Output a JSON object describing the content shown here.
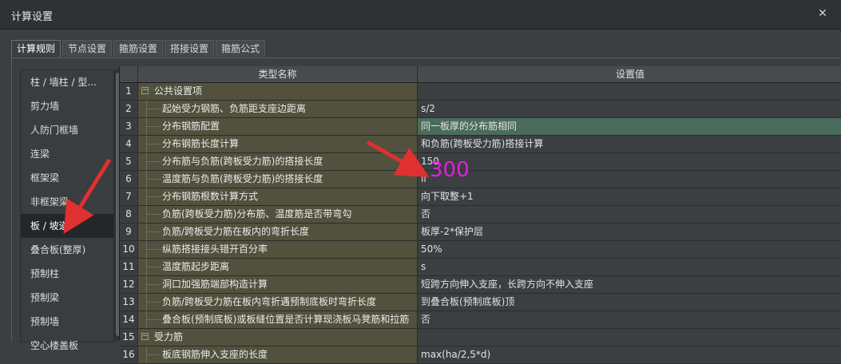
{
  "window": {
    "title": "计算设置"
  },
  "tabs": [
    {
      "label": "计算规则"
    },
    {
      "label": "节点设置"
    },
    {
      "label": "箍筋设置"
    },
    {
      "label": "搭接设置"
    },
    {
      "label": "箍筋公式"
    }
  ],
  "sidebar": {
    "items": [
      {
        "label": "柱 / 墙柱 / 型..."
      },
      {
        "label": "剪力墙"
      },
      {
        "label": "人防门框墙"
      },
      {
        "label": "连梁"
      },
      {
        "label": "框架梁"
      },
      {
        "label": "非框架梁"
      },
      {
        "label": "板 / 坡道"
      },
      {
        "label": "叠合板(整厚)"
      },
      {
        "label": "预制柱"
      },
      {
        "label": "预制梁"
      },
      {
        "label": "预制墙"
      },
      {
        "label": "空心楼盖板"
      }
    ],
    "selected": "板 / 坡道"
  },
  "grid": {
    "columns": [
      {
        "label": "类型名称"
      },
      {
        "label": "设置值"
      }
    ],
    "rows": [
      {
        "num": "1",
        "name": "公共设置项",
        "value": ""
      },
      {
        "num": "2",
        "name": "起始受力钢筋、负筋距支座边距离",
        "value": "s/2"
      },
      {
        "num": "3",
        "name": "分布钢筋配置",
        "value": "同一板厚的分布筋相同"
      },
      {
        "num": "4",
        "name": "分布钢筋长度计算",
        "value": "和负筋(跨板受力筋)搭接计算"
      },
      {
        "num": "5",
        "name": "分布筋与负筋(跨板受力筋)的搭接长度",
        "value": "150"
      },
      {
        "num": "6",
        "name": "温度筋与负筋(跨板受力筋)的搭接长度",
        "value": "ll"
      },
      {
        "num": "7",
        "name": "分布钢筋根数计算方式",
        "value": "向下取整+1"
      },
      {
        "num": "8",
        "name": "负筋(跨板受力筋)分布筋、温度筋是否带弯勾",
        "value": "否"
      },
      {
        "num": "9",
        "name": "负筋/跨板受力筋在板内的弯折长度",
        "value": "板厚-2*保护层"
      },
      {
        "num": "10",
        "name": "纵筋搭接接头错开百分率",
        "value": "50%"
      },
      {
        "num": "11",
        "name": "温度筋起步距离",
        "value": "s"
      },
      {
        "num": "12",
        "name": "洞口加强筋端部构造计算",
        "value": "短跨方向伸入支座，长跨方向不伸入支座"
      },
      {
        "num": "13",
        "name": "负筋/跨板受力筋在板内弯折遇预制底板时弯折长度",
        "value": "到叠合板(预制底板)顶"
      },
      {
        "num": "14",
        "name": "叠合板(预制底板)或板缝位置是否计算现浇板马凳筋和拉筋",
        "value": "否"
      },
      {
        "num": "15",
        "name": "受力筋",
        "value": ""
      },
      {
        "num": "16",
        "name": "板底钢筋伸入支座的长度",
        "value": "max(ha/2,5*d)"
      }
    ]
  },
  "annotation": {
    "text": "300",
    "color": "#e21fe1"
  },
  "colors": {
    "name_column_bg": "#51513d",
    "highlight_row_bg": "#4b6c5c",
    "arrow": "#e03030"
  }
}
